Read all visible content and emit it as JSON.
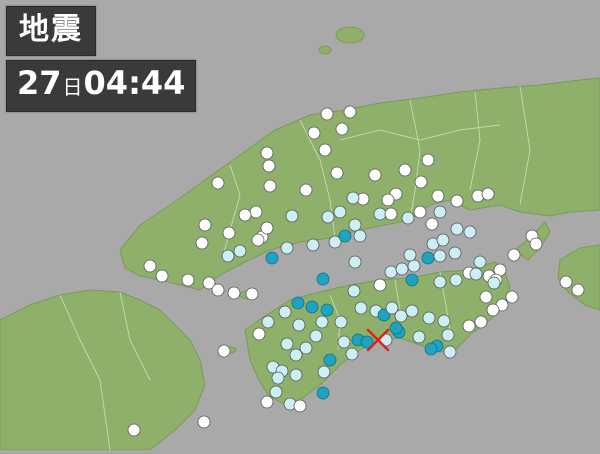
{
  "title": "地震",
  "time": {
    "day": "27",
    "day_unit": "日",
    "clock": "04:44"
  },
  "colors": {
    "sea": "#a9a9a9",
    "land": "#8fb06a",
    "land_dark": "#7a9a58",
    "border": "#c9d9b4",
    "station_outer": "#ffffff",
    "intensity_1": "#ffffff",
    "intensity_2": "#cceef5",
    "intensity_3": "#20a3c0",
    "epicenter": "#e02020"
  },
  "legend_meaning": {
    "icon": "epicenter-x-icon",
    "markers": "station-circle-icon"
  }
}
